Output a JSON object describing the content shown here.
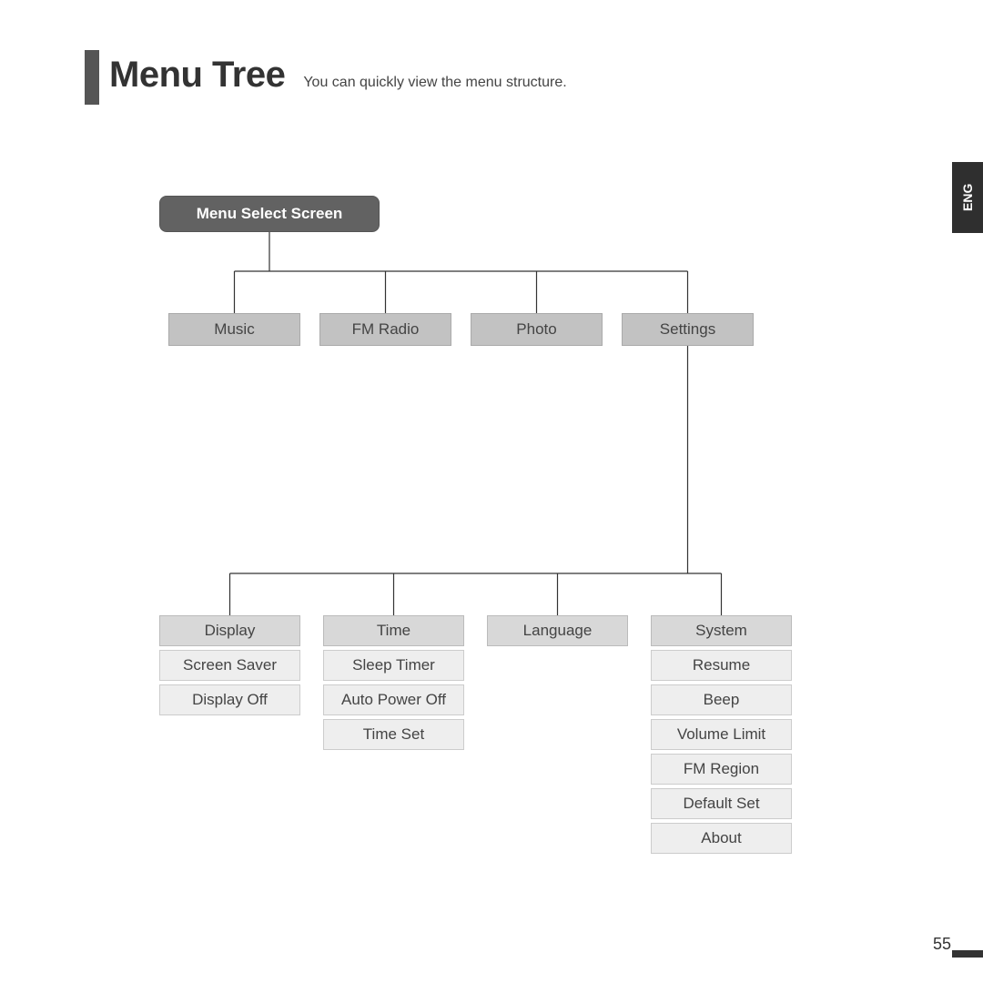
{
  "header": {
    "title": "Menu Tree",
    "subtitle": "You can quickly view the menu structure."
  },
  "lang_tab": "ENG",
  "page_number": "55",
  "tree": {
    "root": "Menu Select Screen",
    "level1": {
      "music": "Music",
      "fm_radio": "FM Radio",
      "photo": "Photo",
      "settings": "Settings"
    },
    "settings_children": {
      "display": {
        "label": "Display",
        "items": [
          "Screen Saver",
          "Display Off"
        ]
      },
      "time": {
        "label": "Time",
        "items": [
          "Sleep Timer",
          "Auto Power Off",
          "Time Set"
        ]
      },
      "language": {
        "label": "Language",
        "items": []
      },
      "system": {
        "label": "System",
        "items": [
          "Resume",
          "Beep",
          "Volume Limit",
          "FM Region",
          "Default Set",
          "About"
        ]
      }
    }
  }
}
